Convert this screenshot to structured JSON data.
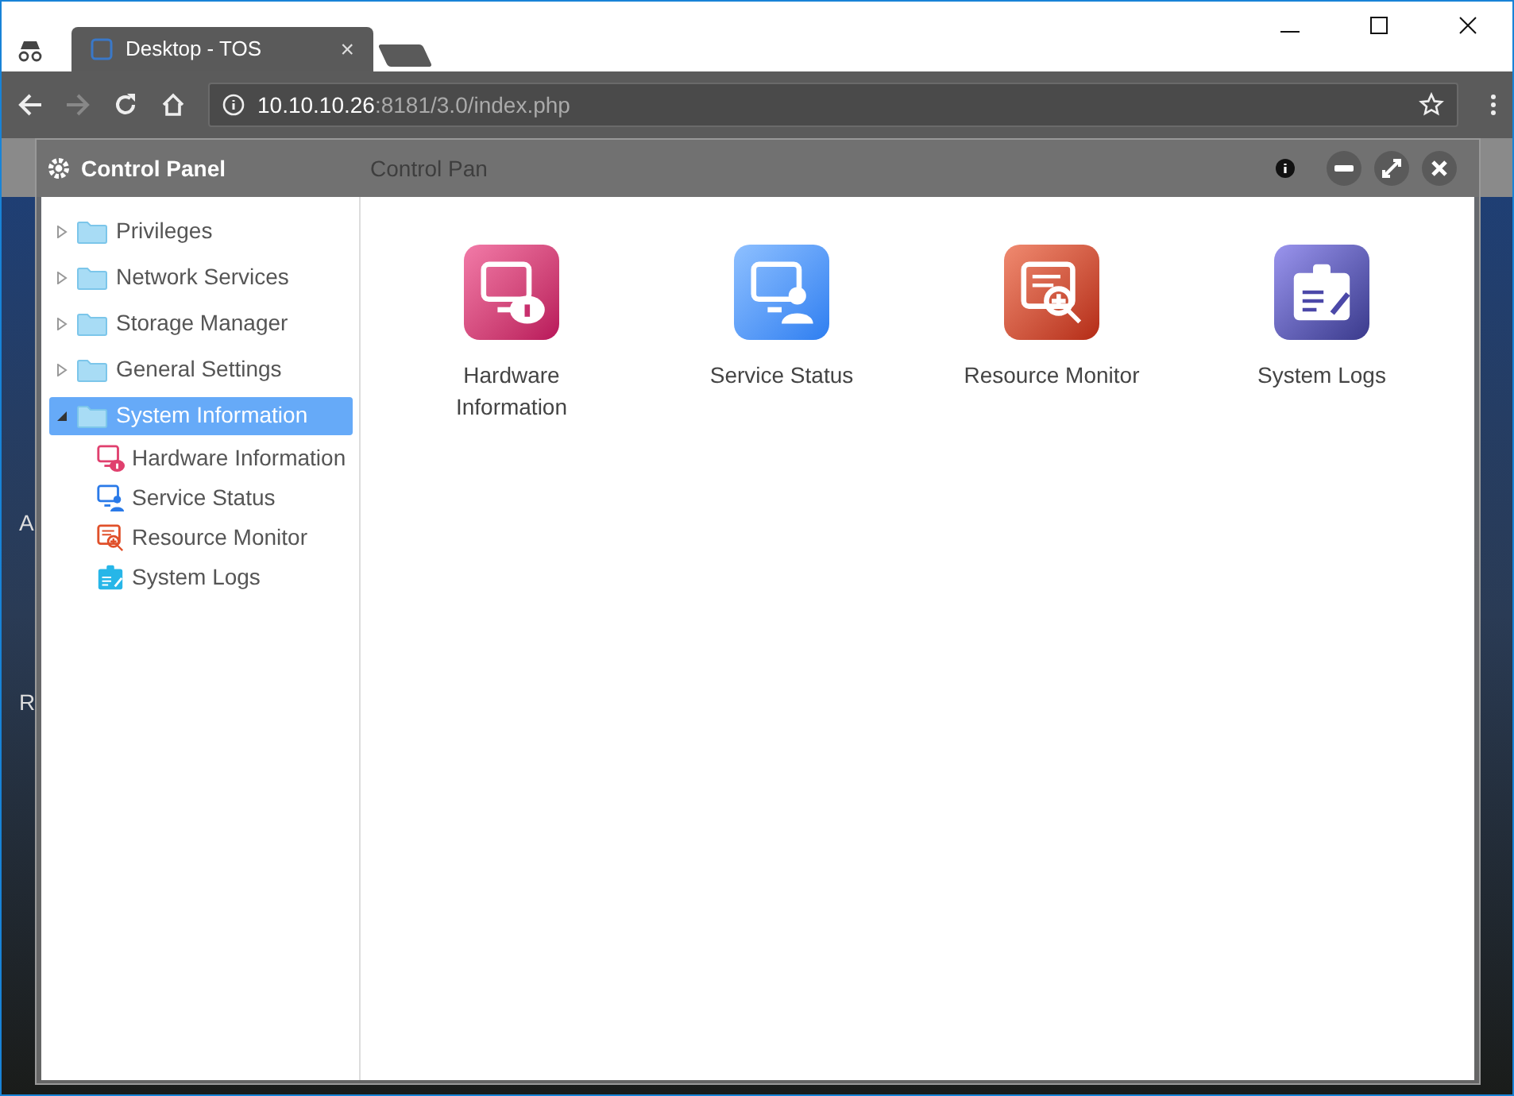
{
  "browser": {
    "tab": {
      "title": "Desktop - TOS",
      "close": "×"
    },
    "address": {
      "host": "10.10.10.26",
      "path": ":8181/3.0/index.php"
    }
  },
  "desktop": {
    "taskbar_item": "Control Pan",
    "icon_labels": [
      "A",
      "R"
    ]
  },
  "window": {
    "title": "Control Panel"
  },
  "sidebar": {
    "items": [
      {
        "label": "Privileges",
        "expanded": false,
        "selected": false
      },
      {
        "label": "Network Services",
        "expanded": false,
        "selected": false
      },
      {
        "label": "Storage Manager",
        "expanded": false,
        "selected": false
      },
      {
        "label": "General Settings",
        "expanded": false,
        "selected": false
      },
      {
        "label": "System Information",
        "expanded": true,
        "selected": true,
        "children": [
          {
            "label": "Hardware Information",
            "kind": "hardware",
            "selected": false
          },
          {
            "label": "Service Status",
            "kind": "service",
            "selected": false
          },
          {
            "label": "Resource Monitor",
            "kind": "resource",
            "selected": false
          },
          {
            "label": "System Logs",
            "kind": "logs",
            "selected": false
          }
        ]
      }
    ]
  },
  "tiles": [
    {
      "label": "Hardware Information",
      "kind": "hardware"
    },
    {
      "label": "Service Status",
      "kind": "service"
    },
    {
      "label": "Resource Monitor",
      "kind": "resource"
    },
    {
      "label": "System Logs",
      "kind": "logs"
    }
  ]
}
